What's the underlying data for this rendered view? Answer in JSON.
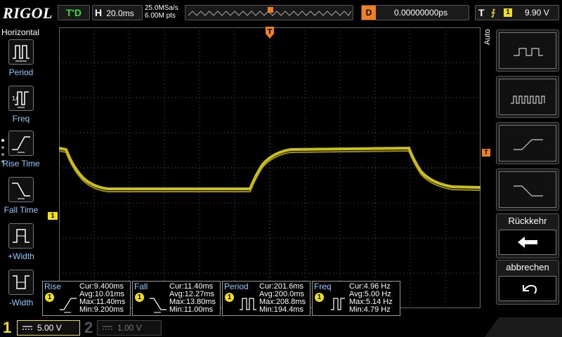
{
  "header": {
    "logo": "RIGOL",
    "run_status": "T'D",
    "timebase_label": "H",
    "timebase_value": "20.0ms",
    "sample_rate": "25.0MSa/s",
    "memory_depth": "6.00M pts",
    "trigger_marker": "T",
    "delay_label": "D",
    "delay_value": "0.00000000ps",
    "trigger_label": "T",
    "trigger_edge": "rising-edge-icon",
    "trigger_source": "1",
    "trigger_level": "9.90 V"
  },
  "left_menu": {
    "title": "Horizontal",
    "items": [
      {
        "label": "Period",
        "icon": "period-icon"
      },
      {
        "label": "Freq",
        "icon": "frequency-icon"
      },
      {
        "label": "Rise Time",
        "icon": "rise-time-icon"
      },
      {
        "label": "Fall Time",
        "icon": "fall-time-icon"
      },
      {
        "label": "+Width",
        "icon": "positive-width-icon"
      },
      {
        "label": "-Width",
        "icon": "negative-width-icon"
      }
    ]
  },
  "right_menu": {
    "auto_label": "Auto",
    "tiles": [
      "square-wave-icon",
      "pulse-train-icon",
      "rising-step-icon",
      "falling-step-icon"
    ],
    "back_label": "Rückkehr",
    "cancel_label": "abbrechen"
  },
  "markers": {
    "channel_1": "1",
    "trigger_level_marker": "T"
  },
  "measurements": [
    {
      "name": "Rise",
      "channel": "1",
      "cur": "Cur:9.400ms",
      "avg": "Avg:10.01ms",
      "max": "Max:11.40ms",
      "min": "Min:9.200ms"
    },
    {
      "name": "Fall",
      "channel": "1",
      "cur": "Cur:11.40ms",
      "avg": "Avg:12.27ms",
      "max": "Max:13.80ms",
      "min": "Min:11.00ms"
    },
    {
      "name": "Period",
      "channel": "1",
      "cur": "Cur:201.6ms",
      "avg": "Avg:200.0ms",
      "max": "Max:208.8ms",
      "min": "Min:194.4ms"
    },
    {
      "name": "Freq",
      "channel": "1",
      "cur": "Cur:4.96 Hz",
      "avg": "Avg:5.00 Hz",
      "max": "Max:5.14 Hz",
      "min": "Min:4.79 Hz"
    }
  ],
  "bottom": {
    "ch1_num": "1",
    "ch1_scale": "5.00 V",
    "ch2_num": "2",
    "ch2_scale": "1.00 V"
  },
  "colors": {
    "channel1": "#f0e020",
    "trigger": "#f08020",
    "menu_text": "#8fc8ff"
  }
}
